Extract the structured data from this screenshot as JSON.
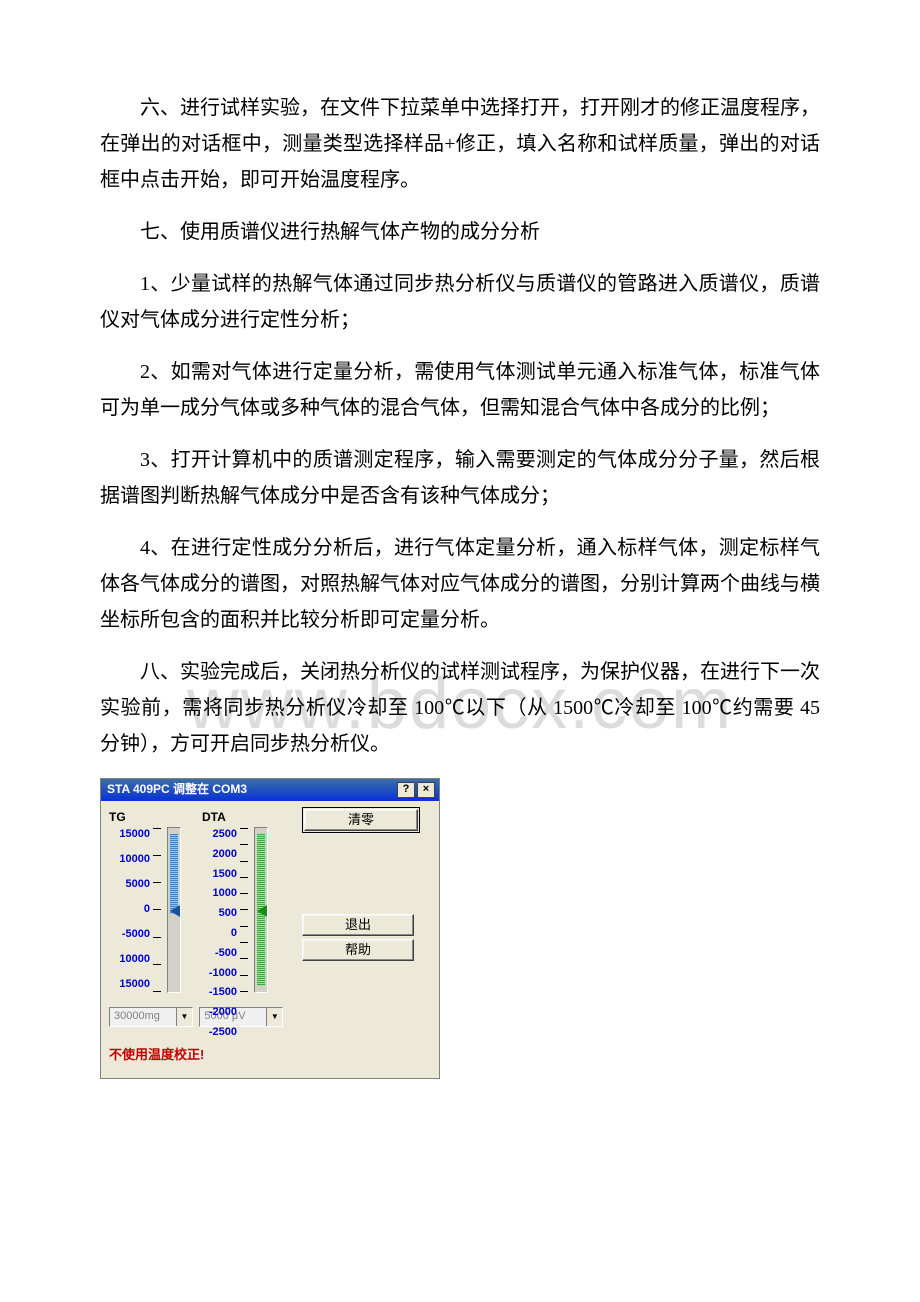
{
  "watermark": "www.bdocx.com",
  "paras": {
    "p1": "六、进行试样实验，在文件下拉菜单中选择打开，打开刚才的修正温度程序，在弹出的对话框中，测量类型选择样品+修正，填入名称和试样质量，弹出的对话框中点击开始，即可开始温度程序。",
    "p2": "七、使用质谱仪进行热解气体产物的成分分析",
    "p3": "1、少量试样的热解气体通过同步热分析仪与质谱仪的管路进入质谱仪，质谱仪对气体成分进行定性分析；",
    "p4": "2、如需对气体进行定量分析，需使用气体测试单元通入标准气体，标准气体可为单一成分气体或多种气体的混合气体，但需知混合气体中各成分的比例；",
    "p5": "3、打开计算机中的质谱测定程序，输入需要测定的气体成分分子量，然后根据谱图判断热解气体成分中是否含有该种气体成分；",
    "p6": "4、在进行定性成分分析后，进行气体定量分析，通入标样气体，测定标样气体各气体成分的谱图，对照热解气体对应气体成分的谱图，分别计算两个曲线与横坐标所包含的面积并比较分析即可定量分析。",
    "p7": "八、实验完成后，关闭热分析仪的试样测试程序，为保护仪器，在进行下一次实验前，需将同步热分析仪冷却至 100℃以下（从 1500℃冷却至 100℃约需要 45 分钟），方可开启同步热分析仪。"
  },
  "dialog": {
    "title": "STA 409PC 调整在 COM3",
    "help_btn": "?",
    "close_btn": "×",
    "tg_label": "TG",
    "dta_label": "DTA",
    "tg_ticks": [
      "15000",
      "10000",
      "5000",
      "0",
      "-5000",
      "10000",
      "15000"
    ],
    "dta_ticks": [
      "2500",
      "2000",
      "1500",
      "1000",
      "500",
      "0",
      "-500",
      "-1000",
      "-1500",
      "-2000",
      "-2500"
    ],
    "btn_clear": "清零",
    "btn_exit": "退出",
    "btn_help": "帮助",
    "tg_combo": "30000mg",
    "dta_combo": "5000 μV",
    "status": "不使用温度校正!"
  }
}
